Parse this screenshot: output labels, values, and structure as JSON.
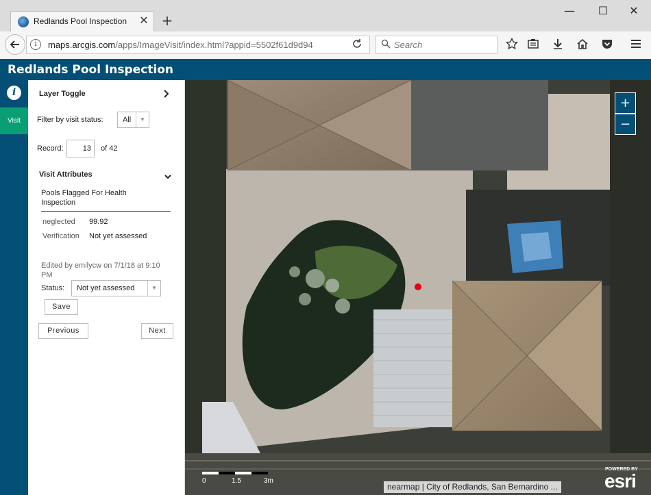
{
  "browser": {
    "tab_title": "Redlands Pool Inspection",
    "tab_close": "✕",
    "new_tab": "+",
    "url_domain": "maps.arcgis.com",
    "url_path": "/apps/ImageVisit/index.html?appid=5502f61d9d94",
    "search_placeholder": "Search",
    "window_controls": {
      "minimize": "—",
      "maximize": "☐",
      "close": "✕"
    }
  },
  "app": {
    "title": "Redlands Pool Inspection",
    "rail": {
      "info_icon": "i",
      "visit_label": "Visit"
    }
  },
  "panel": {
    "layer_toggle": "Layer Toggle",
    "filter_label": "Filter by visit status:",
    "filter_value": "All",
    "record_label": "Record:",
    "record_value": "13",
    "record_total": "of 42",
    "visit_attributes": "Visit Attributes",
    "attr_title": "Pools Flagged For Health Inspection",
    "attributes": [
      {
        "key": "neglected",
        "value": "99.92"
      },
      {
        "key": "Verification",
        "value": "Not yet assessed"
      }
    ],
    "edited_by": "Edited by emilycw on 7/1/18 at 9:10 PM",
    "status_label": "Status:",
    "status_value": "Not yet assessed",
    "save_label": "Save",
    "previous_label": "Previous",
    "next_label": "Next"
  },
  "map": {
    "zoom_in": "+",
    "zoom_out": "−",
    "scale_labels": [
      "0",
      "1.5",
      "3m"
    ],
    "attribution": "nearmap | City of Redlands, San Bernardino ...",
    "powered_by": "POWERED BY",
    "esri": "esri",
    "marker_color": "#e8000b"
  },
  "colors": {
    "header_bg": "#034f75",
    "visit_tab": "#0a9e74"
  }
}
